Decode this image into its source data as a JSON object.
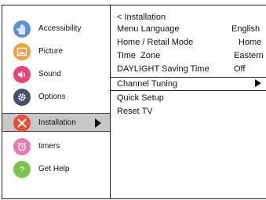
{
  "sidebar": {
    "items": [
      {
        "label": "Accessibility",
        "icon": "hand-icon",
        "color": "#5b8fd6"
      },
      {
        "label": "Picture",
        "icon": "picture-icon",
        "color": "#f0a23a"
      },
      {
        "label": "Sound",
        "icon": "speaker-icon",
        "color": "#e6457a"
      },
      {
        "label": "Options",
        "icon": "gear-icon",
        "color": "#4a4f6e"
      },
      {
        "label": "Installation",
        "icon": "tools-icon",
        "color": "#e8503c"
      },
      {
        "label": "timers",
        "icon": "alarm-clock-icon",
        "color": "#e47ab3"
      },
      {
        "label": "Get Help",
        "icon": "help-icon",
        "color": "#7cc24e"
      }
    ],
    "active_index": 4
  },
  "menu": {
    "title": "< Installation",
    "rows": [
      {
        "label": "Menu Language",
        "value": "English"
      },
      {
        "label": "Home / Retail Mode",
        "value": "Home"
      },
      {
        "label": "Time  Zone",
        "value": "Eastern"
      },
      {
        "label": "DAYLIGHT Saving Time",
        "value": "Off"
      },
      {
        "label": "Channel Tuning",
        "value": ""
      },
      {
        "label": "Quick Setup",
        "value": ""
      },
      {
        "label": "Reset TV",
        "value": ""
      }
    ],
    "selected_index": 4
  }
}
